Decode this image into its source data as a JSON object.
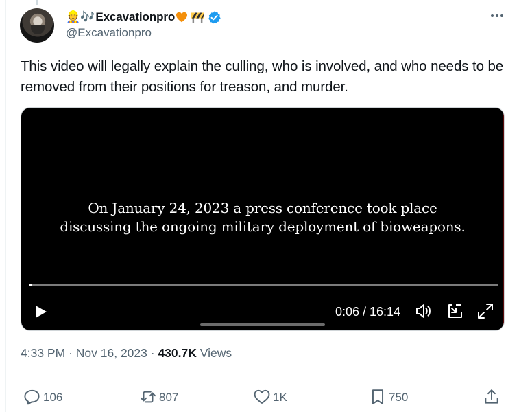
{
  "author": {
    "prefix_emoji": "👷🎶",
    "display_name": "Excavationpro",
    "handle": "@Excavationpro"
  },
  "tweet": {
    "text": "This video will legally explain the culling, who is involved, and who needs to be removed from their positions for treason, and murder."
  },
  "video": {
    "caption_line1": "On January 24, 2023 a press conference took place",
    "caption_line2": "discussing the ongoing military deployment of bioweapons.",
    "time_display": "0:06 / 16:14",
    "progress_fraction": 0.006
  },
  "meta": {
    "time": "4:33 PM",
    "separator": "·",
    "date": "Nov 16, 2023",
    "views_count": "430.7K",
    "views_label": "Views"
  },
  "actions": {
    "replies": "106",
    "reposts": "807",
    "likes": "1K",
    "bookmarks": "750"
  },
  "colors": {
    "text": "#0f1419",
    "secondary": "#536471",
    "verified": "#1d9bf0",
    "divider": "#eff3f4",
    "video_bg": "#000000"
  },
  "icons": {
    "more": "more-horizontal-icon",
    "verified": "verified-badge-icon",
    "play": "play-icon",
    "mute": "volume-icon",
    "pip": "picture-in-picture-icon",
    "fullscreen": "fullscreen-icon",
    "reply": "reply-icon",
    "repost": "repost-icon",
    "like": "heart-icon",
    "bookmark": "bookmark-icon",
    "share": "share-icon"
  }
}
